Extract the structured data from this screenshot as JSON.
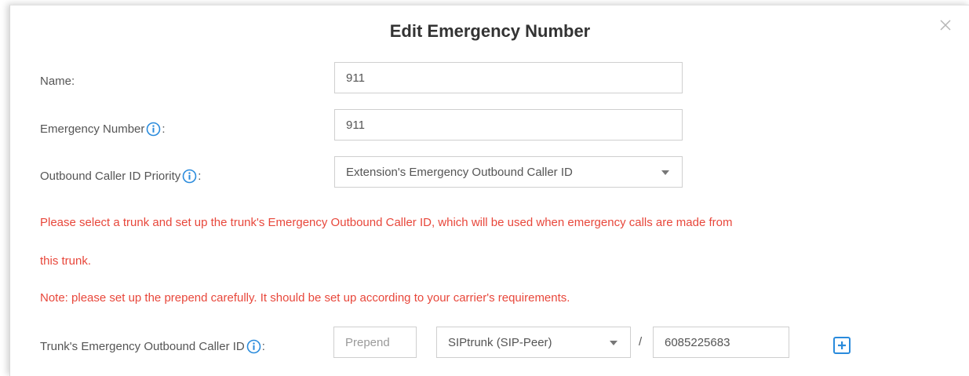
{
  "dialog": {
    "title": "Edit Emergency Number"
  },
  "fields": {
    "name": {
      "label": "Name:",
      "value": "911"
    },
    "emergency_number": {
      "label": "Emergency Number",
      "label_suffix": ":",
      "value": "911"
    },
    "caller_id_priority": {
      "label": "Outbound Caller ID Priority",
      "label_suffix": ":",
      "selected": "Extension's Emergency Outbound Caller ID"
    }
  },
  "notices": {
    "trunk_line1": "Please select a trunk and set up the trunk's Emergency Outbound Caller ID, which will be used when emergency calls are made from",
    "trunk_line2": "this trunk.",
    "prepend_note": "Note: please set up the prepend carefully. It should be set up according to your carrier's requirements."
  },
  "trunk_row": {
    "label": "Trunk's Emergency Outbound Caller ID",
    "label_suffix": ":",
    "prepend_placeholder": "Prepend",
    "trunk_selected": "SIPtrunk (SIP-Peer)",
    "separator": "/",
    "caller_id_value": "6085225683"
  },
  "icons": {
    "close": "close-icon",
    "info": "info-icon",
    "add": "plus-square-icon",
    "dropdown": "caret-down-icon"
  },
  "colors": {
    "accent": "#2a8bdc",
    "warning": "#e8473b",
    "text": "#555555",
    "title": "#333333"
  }
}
